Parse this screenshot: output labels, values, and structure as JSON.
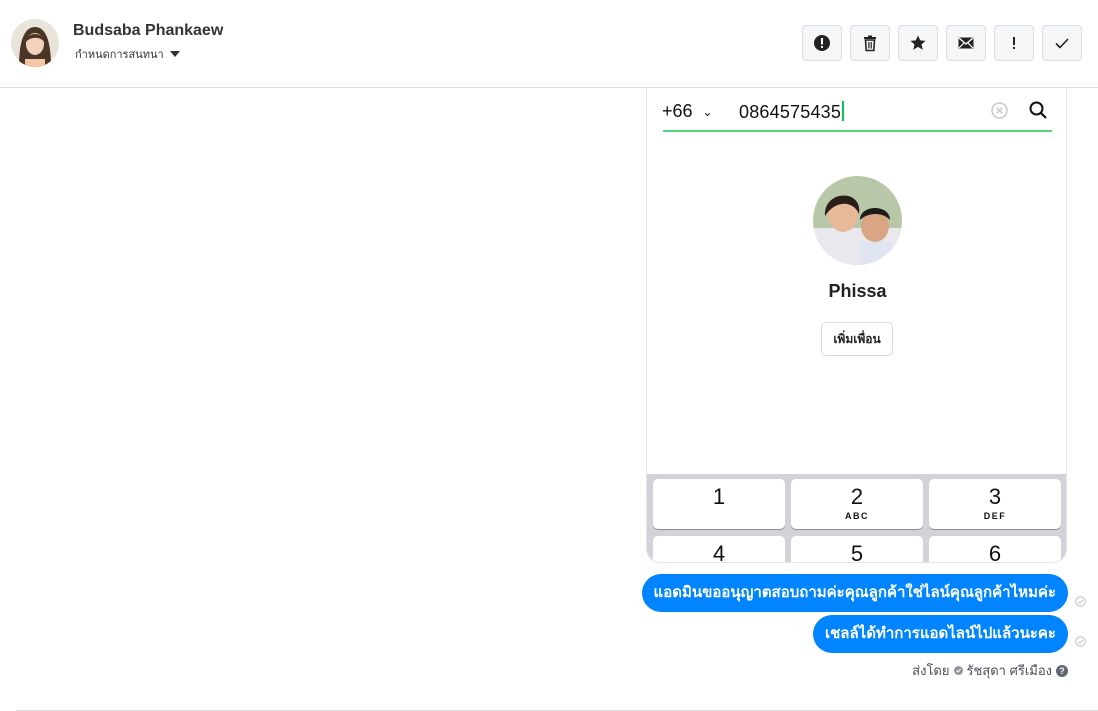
{
  "header": {
    "contact_name": "Budsaba Phankaew",
    "subtitle": "กำหนดการสนทนา",
    "toolbar": [
      {
        "icon": "alert-circle-icon"
      },
      {
        "icon": "trash-icon"
      },
      {
        "icon": "star-icon"
      },
      {
        "icon": "envelope-icon"
      },
      {
        "icon": "exclamation-icon"
      },
      {
        "icon": "checkmark-icon"
      }
    ]
  },
  "attachment": {
    "country_code": "+66",
    "phone_number": "0864575435",
    "friend_name": "Phissa",
    "add_friend_label": "เพิ่มเพื่อน",
    "keys": [
      {
        "digit": "1",
        "letters": ""
      },
      {
        "digit": "2",
        "letters": "ABC"
      },
      {
        "digit": "3",
        "letters": "DEF"
      },
      {
        "digit": "4",
        "letters": ""
      },
      {
        "digit": "5",
        "letters": ""
      },
      {
        "digit": "6",
        "letters": ""
      }
    ]
  },
  "messages": [
    {
      "text": "แอดมินขออนุญาตสอบถามค่ะคุณลูกค้าใช่ไลน์คุณลูกค้าไหมค่ะ"
    },
    {
      "text": "เชลล์ได้ทำการแอดไลน์ไปแล้วนะคะ"
    }
  ],
  "sent_by": {
    "prefix": "ส่งโดย",
    "agent_name": "รัชสุดา ศรีเมือง"
  },
  "colors": {
    "bubble": "#0084ff",
    "line_green": "#06c755"
  }
}
